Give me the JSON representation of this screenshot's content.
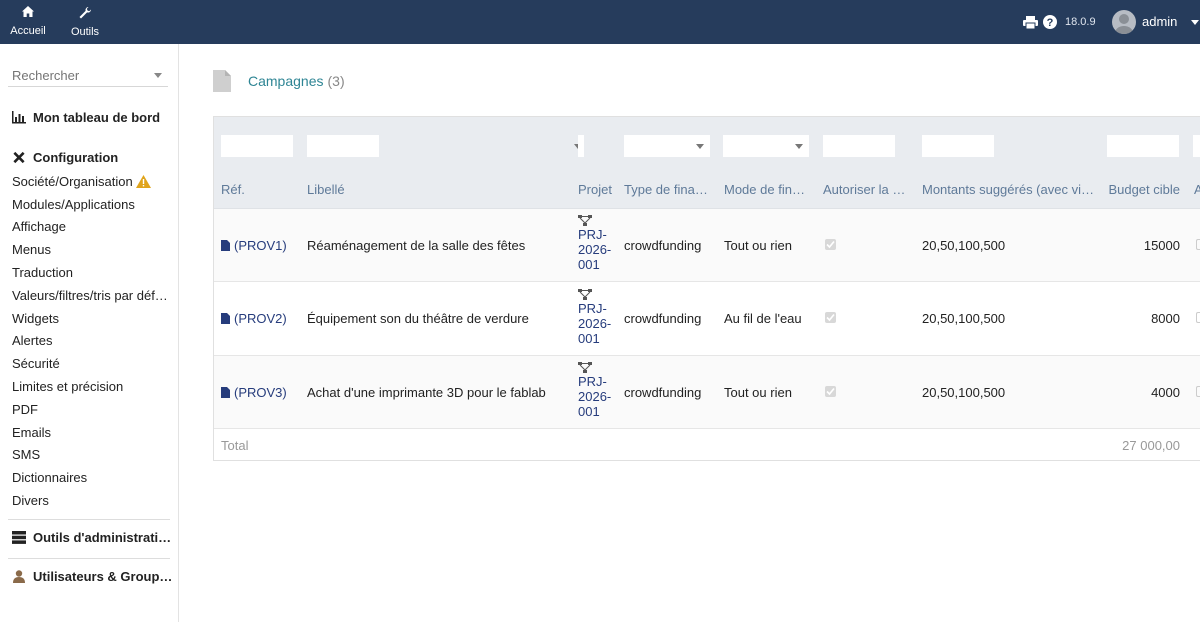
{
  "topbar": {
    "nav": [
      {
        "label": "Accueil",
        "icon": "home-icon",
        "active": true
      },
      {
        "label": "Outils",
        "icon": "wrench-icon",
        "active": false
      }
    ],
    "version": "18.0.9",
    "user": "admin"
  },
  "sidebar": {
    "search_placeholder": "Rechercher",
    "dashboard": "Mon tableau de bord",
    "config_heading": "Configuration",
    "items": [
      "Société/Organisation",
      "Modules/Applications",
      "Affichage",
      "Menus",
      "Traduction",
      "Valeurs/filtres/tris par déf…",
      "Widgets",
      "Alertes",
      "Sécurité",
      "Limites et précision",
      "PDF",
      "Emails",
      "SMS",
      "Dictionnaires",
      "Divers"
    ],
    "admin_tools": "Outils d'administrati…",
    "users_groups": "Utilisateurs & Group…"
  },
  "page": {
    "title": "Campagnes",
    "count": "(3)"
  },
  "table": {
    "headers": {
      "ref": "Réf.",
      "libelle": "Libellé",
      "projet": "Projet",
      "type": "Type de fina…",
      "mode": "Mode de fina…",
      "autoriser": "Autoriser la …",
      "montants": "Montants suggérés (avec vir…",
      "budget": "Budget cible",
      "next": "A"
    },
    "rows": [
      {
        "ref": "(PROV1)",
        "libelle": "Réaménagement de la salle des fêtes",
        "projet": [
          "PRJ-",
          "2026-",
          "001"
        ],
        "type": "crowdfunding",
        "mode": "Tout ou rien",
        "autoriser": true,
        "montants": "20,50,100,500",
        "budget": "15000"
      },
      {
        "ref": "(PROV2)",
        "libelle": "Équipement son du théâtre de verdure",
        "projet": [
          "PRJ-",
          "2026-",
          "001"
        ],
        "type": "crowdfunding",
        "mode": "Au fil de l'eau",
        "autoriser": true,
        "montants": "20,50,100,500",
        "budget": "8000"
      },
      {
        "ref": "(PROV3)",
        "libelle": "Achat d'une imprimante 3D pour le fablab",
        "projet": [
          "PRJ-",
          "2026-",
          "001"
        ],
        "type": "crowdfunding",
        "mode": "Tout ou rien",
        "autoriser": true,
        "montants": "20,50,100,500",
        "budget": "4000"
      }
    ],
    "total_label": "Total",
    "total_value": "27 000,00"
  },
  "colors": {
    "topbar": "#263c5c",
    "link": "#263c7c",
    "title": "#2e8594",
    "header_text": "#5f7a99"
  }
}
